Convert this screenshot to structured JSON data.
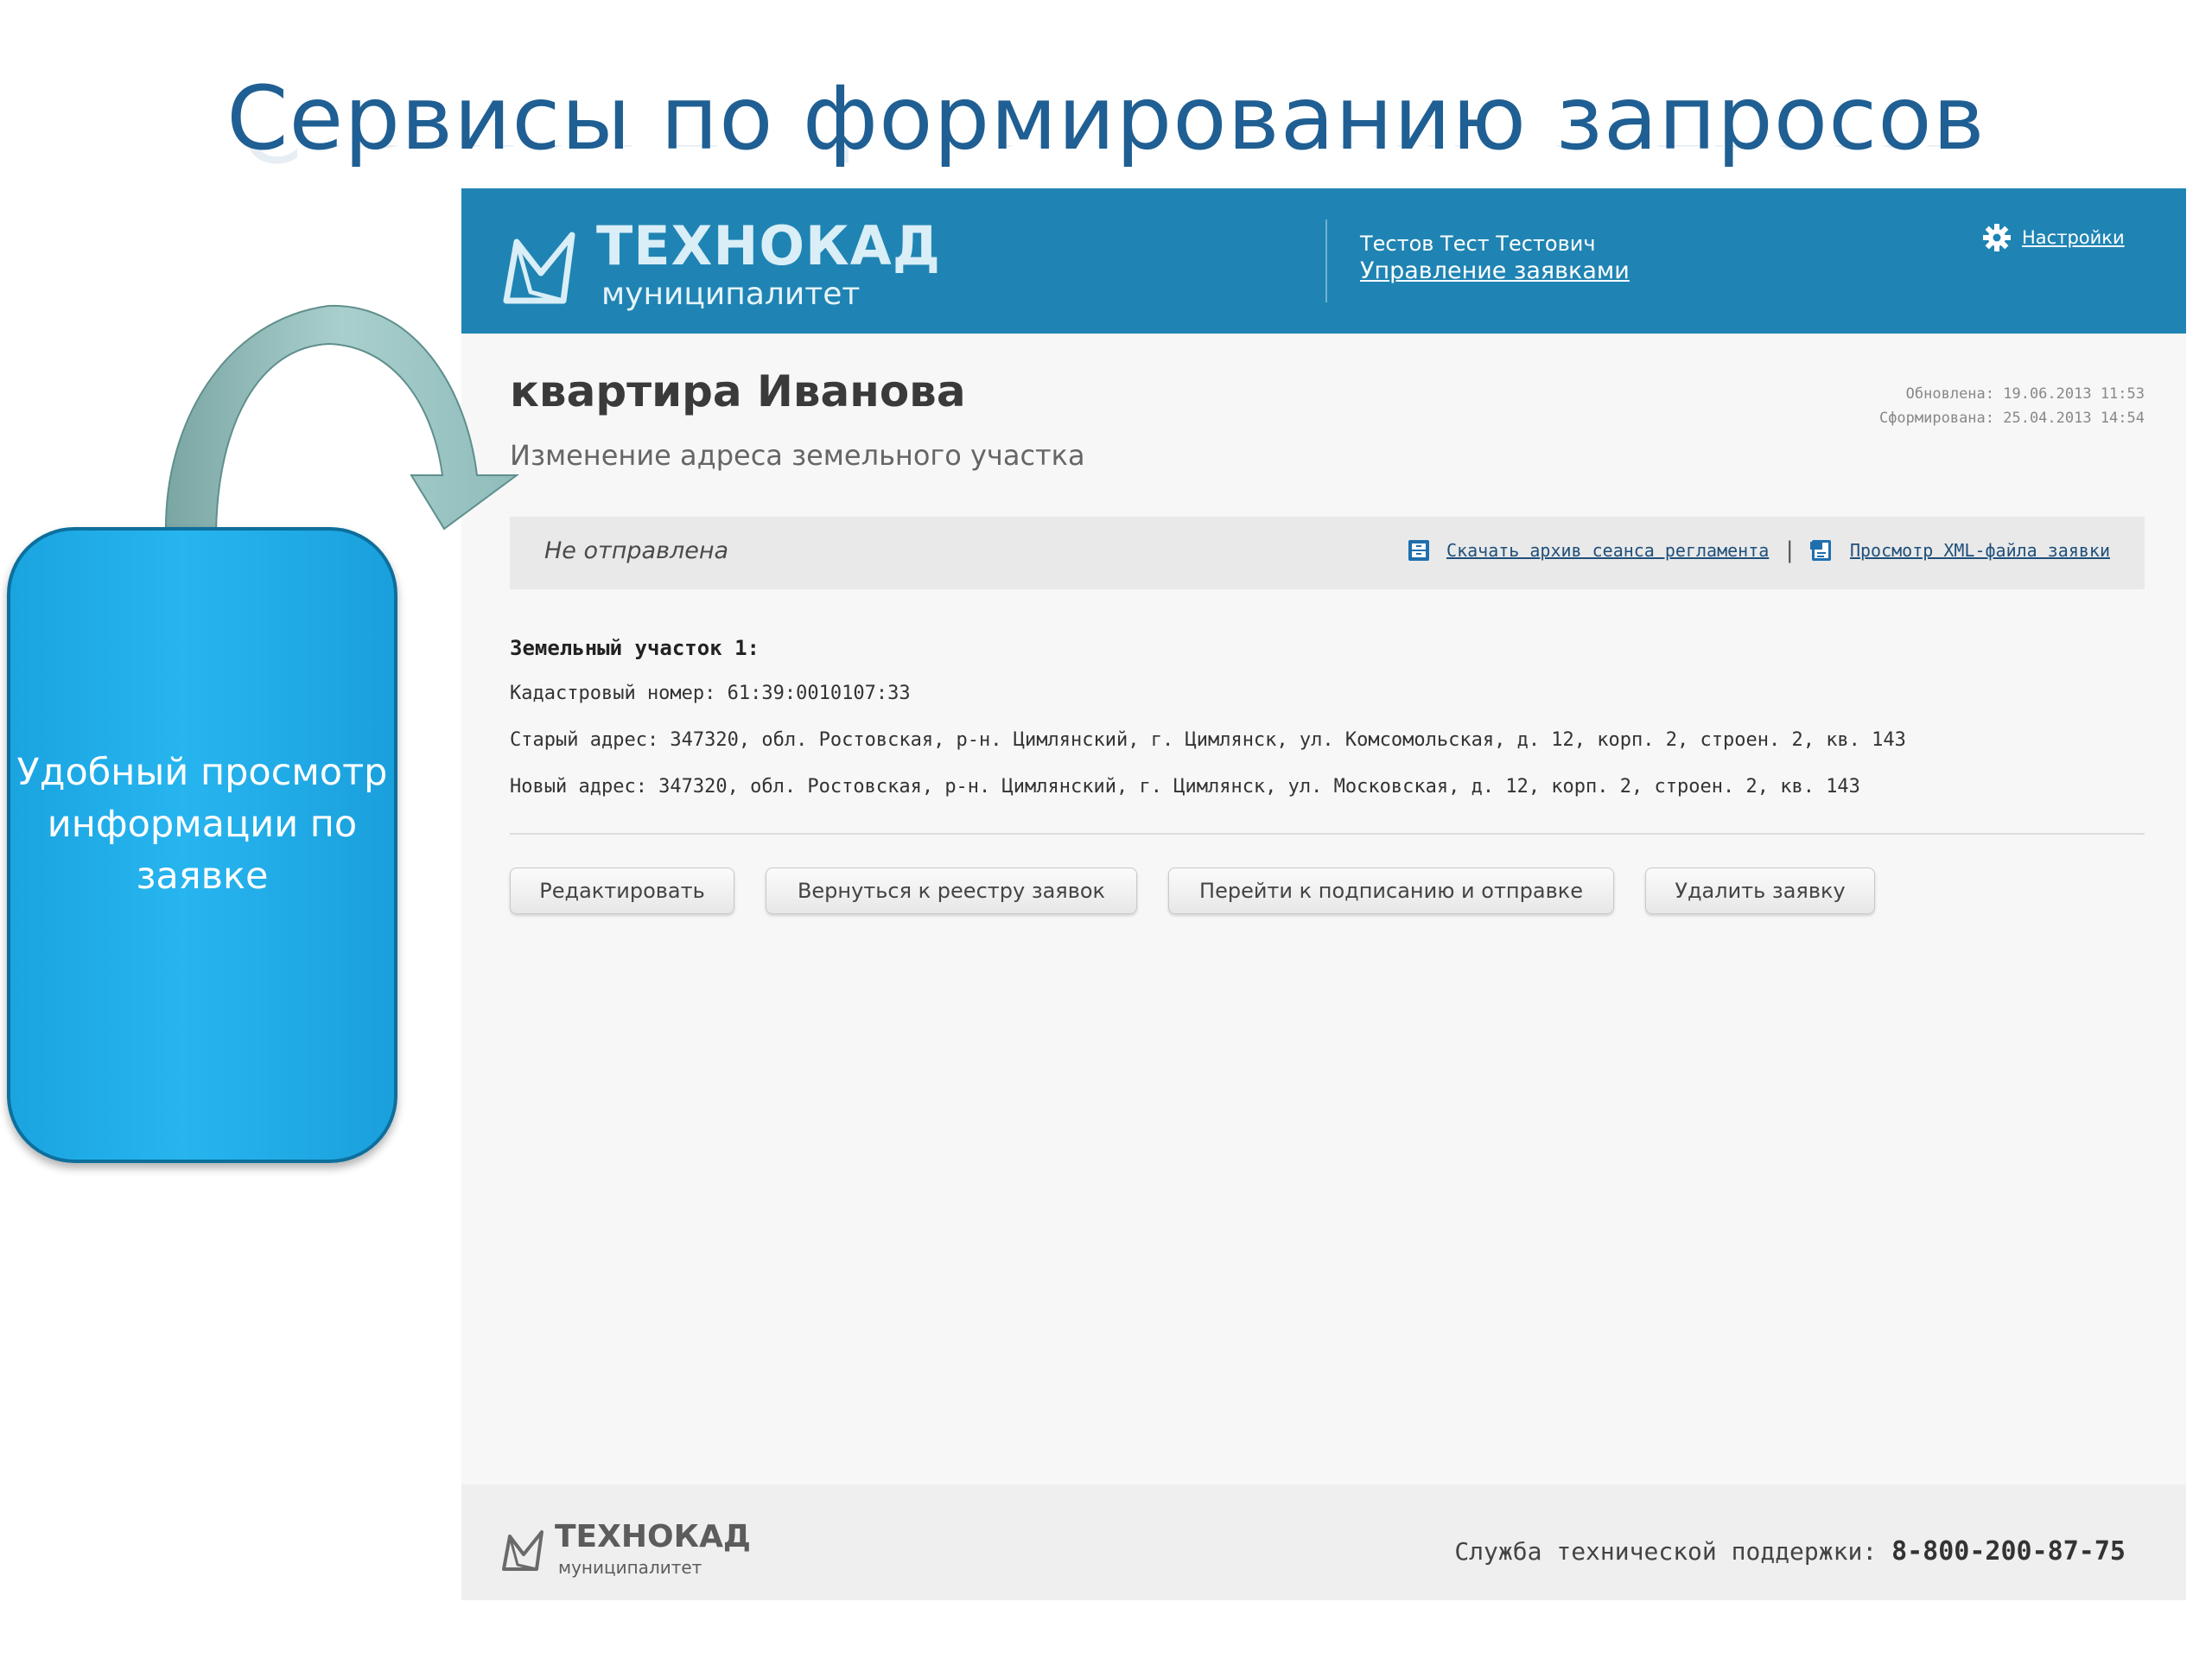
{
  "slide": {
    "title": "Сервисы по формированию запросов",
    "callout_text": "Удобный просмотр информации по заявке"
  },
  "header": {
    "logo_name": "ТЕХНОКАД",
    "logo_sub": "муниципалитет",
    "user_name": "Тестов Тест Тестович",
    "user_link": "Управление заявками",
    "settings_label": "Настройки"
  },
  "page": {
    "title": "квартира Иванова",
    "subtitle": "Изменение адреса земельного участка",
    "updated": "Обновлена: 19.06.2013 11:53",
    "created": "Сформирована: 25.04.2013 14:54"
  },
  "status": {
    "text": "Не отправлена",
    "download_label": "Скачать архив сеанса регламента",
    "separator": "|",
    "xml_label": "Просмотр XML-файла заявки"
  },
  "details": {
    "section_title": "Земельный участок 1:",
    "cadastral": "Кадастровый номер: 61:39:0010107:33",
    "old_address": "Старый адрес: 347320, обл. Ростовская, р-н. Цимлянский, г. Цимлянск, ул. Комсомольская, д. 12, корп. 2, строен. 2, кв. 143",
    "new_address": "Новый адрес: 347320, обл. Ростовская, р-н. Цимлянский, г. Цимлянск, ул. Московская, д. 12, корп. 2, строен. 2, кв. 143"
  },
  "buttons": {
    "edit": "Редактировать",
    "back": "Вернуться к реестру заявок",
    "sign": "Перейти к подписанию и отправке",
    "delete": "Удалить заявку"
  },
  "footer": {
    "logo_name": "ТЕХНОКАД",
    "logo_sub": "муниципалитет",
    "support_label": "Служба технической поддержки:",
    "support_phone": "8-800-200-87-75"
  },
  "colors": {
    "header": "#1f84b3",
    "title": "#1f5f93",
    "callout": "#1aa4e0",
    "arrow": "#8fbcbb"
  },
  "icons": [
    "logo-icon",
    "gear-icon",
    "archive-icon",
    "xml-file-icon",
    "curved-arrow-icon"
  ]
}
